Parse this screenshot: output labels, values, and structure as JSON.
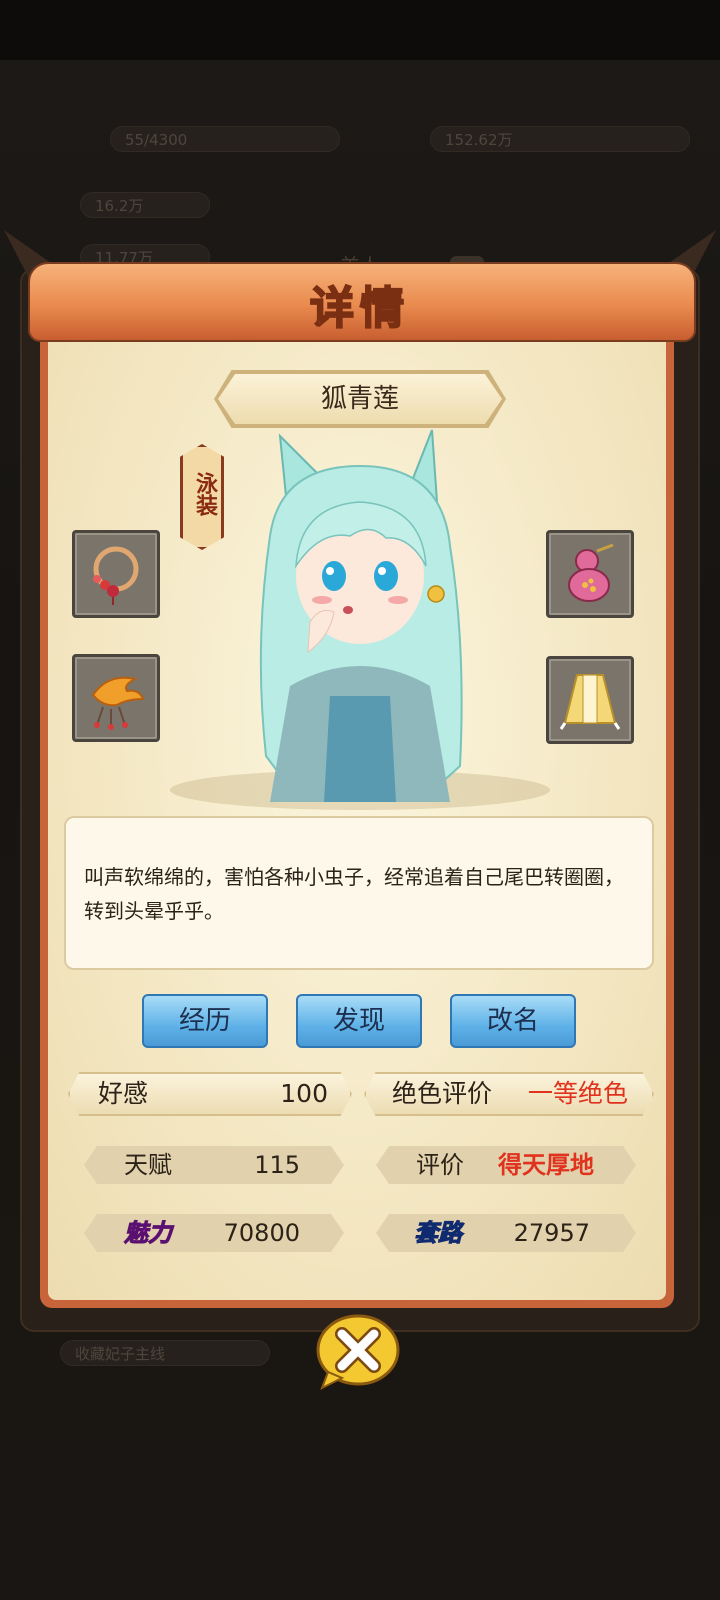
{
  "background": {
    "resource_bar_1": "55/4300",
    "resource_bar_2": "152.62万",
    "resource_bar_3": "16.2万",
    "resource_bar_4": "11.77万",
    "resource_bar_5": "收藏妃子主线"
  },
  "dialog": {
    "title": "详情",
    "background_title": "美人",
    "help_icon": "?"
  },
  "character": {
    "name": "狐青莲",
    "costume_tag": "泳装",
    "description": "叫声软绵绵的，害怕各种小虫子，经常追着自己尾巴转圈圈，转到头晕乎乎。"
  },
  "equipment": {
    "left_top": "necklace-icon",
    "left_bottom": "phoenix-ornament-icon",
    "right_top": "gourd-icon",
    "right_bottom": "robe-icon"
  },
  "buttons": {
    "history": "经历",
    "discover": "发现",
    "rename": "改名"
  },
  "stats": {
    "favor_label": "好感",
    "favor_value": "100",
    "beauty_rating_label": "绝色评价",
    "beauty_rating_value": "一等绝色",
    "talent_label": "天赋",
    "talent_value": "115",
    "rating_label": "评价",
    "rating_value": "得天厚地",
    "charm_label": "魅力",
    "charm_value": "70800",
    "trick_label": "套路",
    "trick_value": "27957"
  },
  "colors": {
    "accent_red": "#e0321c",
    "button_blue": "#5fb2e8",
    "frame_orange": "#c8643a"
  }
}
